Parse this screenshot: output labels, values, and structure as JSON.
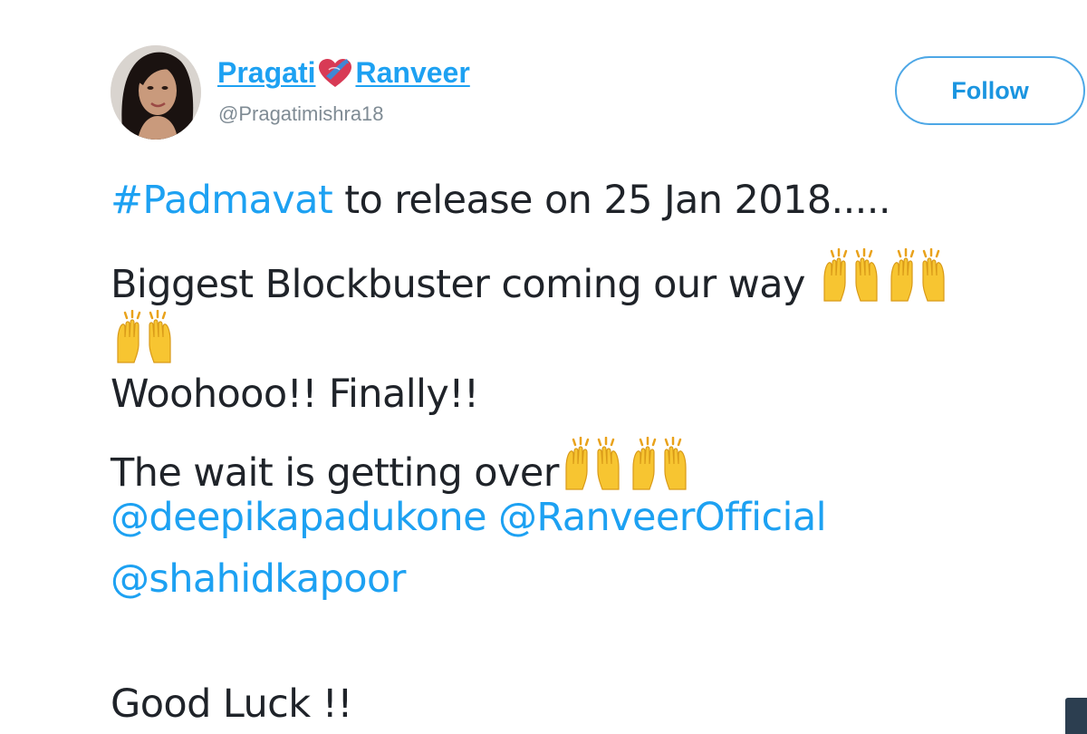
{
  "tweet": {
    "author": {
      "name_first": "Pragati",
      "name_second": "Ranveer",
      "handle": "@Pragatimishra18"
    },
    "follow_label": "Follow",
    "lines": {
      "hashtag": "#Padmavat",
      "line1_rest": " to release on 25 Jan 2018.....",
      "line2": "Biggest Blockbuster coming our way ",
      "line3": "Woohooo!! Finally!!",
      "line4": "The wait is getting over",
      "mention1": "@deepikapadukone",
      "mention2": "@RanveerOfficial",
      "mention3": "@shahidkapoor",
      "line_final": "Good Luck !!"
    }
  },
  "icons": {
    "raised_hands": "raising-hands-emoji",
    "heart": "heart-with-ribbon-emoji"
  },
  "colors": {
    "link": "#1da1f2",
    "text": "#1f2329",
    "handle": "#7f8b94",
    "follow_border": "#4da7e6"
  }
}
